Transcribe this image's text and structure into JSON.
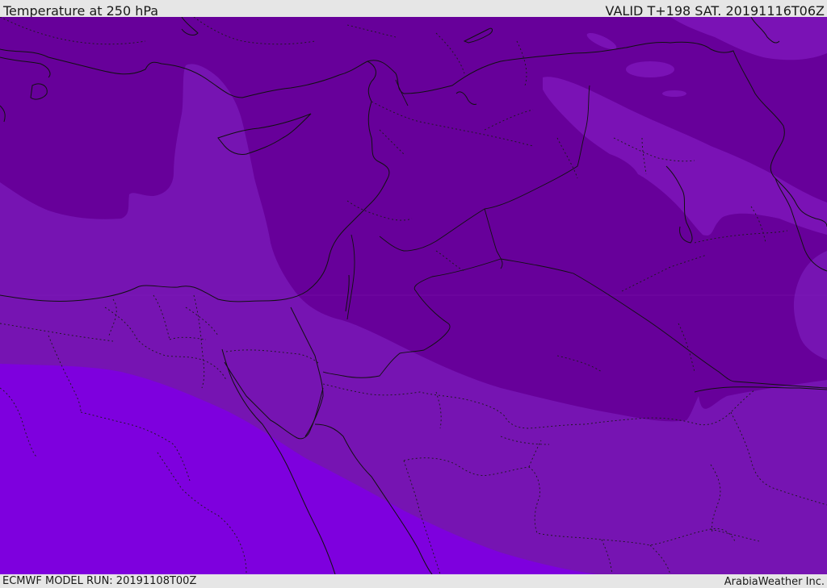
{
  "header": {
    "title": "Temperature at 250 hPa",
    "valid": "VALID T+198 SAT. 20191116T06Z"
  },
  "footer": {
    "model_run": "ECMWF MODEL RUN: 20191108T00Z",
    "brand": "ArabiaWeather Inc."
  },
  "palette": {
    "coldest_band": "#670099",
    "cold_band": "#7512b3",
    "mid_band": "#7a12b5",
    "warm_band": "#7e00de",
    "land_outline": "#111111"
  }
}
